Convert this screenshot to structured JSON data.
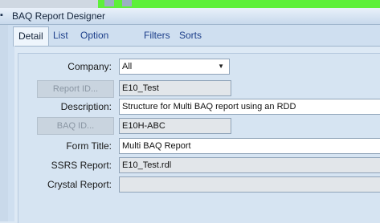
{
  "window": {
    "title": "BAQ Report Designer",
    "pin_glyph": "▪"
  },
  "tabs": [
    {
      "label": "Detail"
    },
    {
      "label": "List"
    },
    {
      "label": "Option Fields"
    },
    {
      "label": "Filters"
    },
    {
      "label": "Sorts"
    }
  ],
  "form": {
    "company_label": "Company:",
    "company_value": "All",
    "report_id_button": "Report ID...",
    "report_id_value": "E10_Test",
    "description_label": "Description:",
    "description_value": "Structure for Multi BAQ report using an RDD",
    "baq_id_button": "BAQ ID...",
    "baq_id_value": "E10H-ABC",
    "form_title_label": "Form Title:",
    "form_title_value": "Multi BAQ Report",
    "ssrs_label": "SSRS Report:",
    "ssrs_value": "E10_Test.rdl",
    "crystal_label": "Crystal Report:",
    "crystal_value": ""
  },
  "icons": {
    "dropdown": "chevron-down-icon",
    "pin": "pin-icon"
  }
}
